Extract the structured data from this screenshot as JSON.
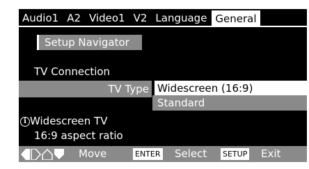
{
  "tabs": [
    {
      "label": "Audio1",
      "active": false
    },
    {
      "label": "A2",
      "active": false
    },
    {
      "label": "Video1",
      "active": false
    },
    {
      "label": "V2",
      "active": false
    },
    {
      "label": "Language",
      "active": false
    },
    {
      "label": "General",
      "active": true
    }
  ],
  "setup_navigator": {
    "label": "Setup Navigator"
  },
  "section": {
    "label": "TV Connection"
  },
  "setting": {
    "label": "TV Type",
    "options": [
      "Widescreen (16:9)",
      "Standard"
    ],
    "selected": "Widescreen (16:9)"
  },
  "info": {
    "icon": "info-icon",
    "title": "Widescreen TV",
    "description": "16:9 aspect ratio"
  },
  "footer": {
    "move_label": "Move",
    "enter_key": "ENTER",
    "select_label": "Select",
    "setup_key": "SETUP",
    "exit_label": "Exit"
  },
  "colors": {
    "background": "#000000",
    "highlight": "#8a8a8a",
    "selected": "#ffffff"
  }
}
